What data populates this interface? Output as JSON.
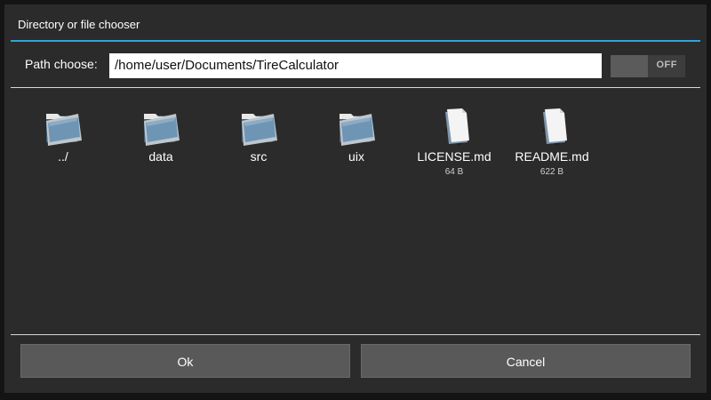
{
  "dialog": {
    "title": "Directory or file chooser"
  },
  "path": {
    "label": "Path choose:",
    "value": "/home/user/Documents/TireCalculator"
  },
  "toggle": {
    "label": "OFF",
    "state": "off"
  },
  "entries": [
    {
      "name": "../",
      "type": "folder",
      "icon": "folder-icon",
      "size": ""
    },
    {
      "name": "data",
      "type": "folder",
      "icon": "folder-icon",
      "size": ""
    },
    {
      "name": "src",
      "type": "folder",
      "icon": "folder-icon",
      "size": ""
    },
    {
      "name": "uix",
      "type": "folder",
      "icon": "folder-icon",
      "size": ""
    },
    {
      "name": "LICENSE.md",
      "type": "file",
      "icon": "file-icon",
      "size": "64 B"
    },
    {
      "name": "README.md",
      "type": "file",
      "icon": "file-icon",
      "size": "622 B"
    }
  ],
  "buttons": {
    "ok": "Ok",
    "cancel": "Cancel"
  },
  "colors": {
    "accent": "#33a3d6",
    "background": "#2b2b2b",
    "button": "#595959"
  }
}
